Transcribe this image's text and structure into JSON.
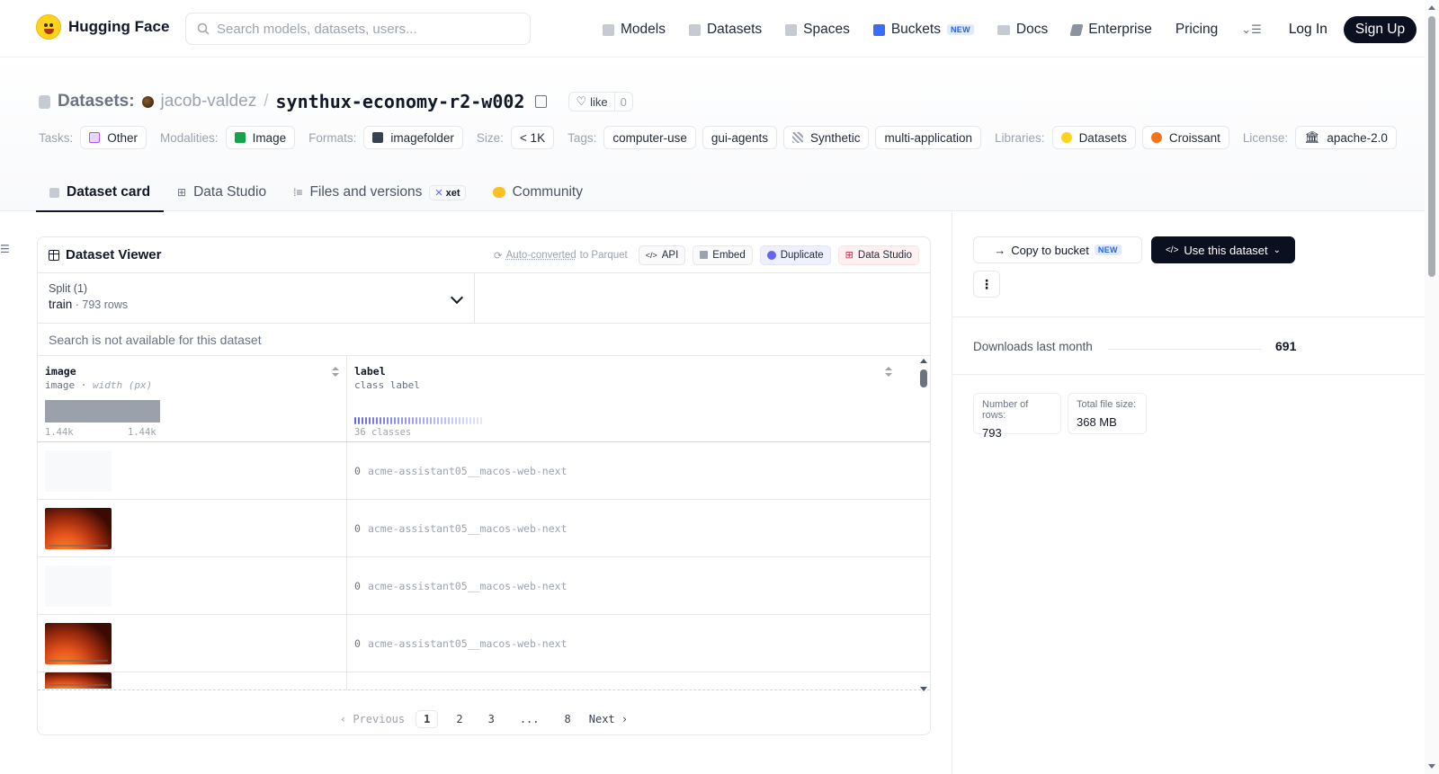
{
  "nav": {
    "brand": "Hugging Face",
    "search_placeholder": "Search models, datasets, users...",
    "items": [
      {
        "label": "Models",
        "icon": "models-icon"
      },
      {
        "label": "Datasets",
        "icon": "datasets-icon"
      },
      {
        "label": "Spaces",
        "icon": "spaces-icon"
      },
      {
        "label": "Buckets",
        "icon": "buckets-icon",
        "badge": "NEW"
      },
      {
        "label": "Docs",
        "icon": "docs-icon"
      },
      {
        "label": "Enterprise",
        "icon": "enterprise-icon"
      },
      {
        "label": "Pricing"
      }
    ],
    "login": "Log In",
    "signup": "Sign Up"
  },
  "header": {
    "section": "Datasets:",
    "user": "jacob-valdez",
    "slash": "/",
    "repo": "synthux-economy-r2-w002",
    "like_label": "like",
    "like_count": "0"
  },
  "tags": {
    "tasks_label": "Tasks:",
    "tasks": "Other",
    "modalities_label": "Modalities:",
    "modalities": "Image",
    "formats_label": "Formats:",
    "formats": "imagefolder",
    "size_label": "Size:",
    "size": "< 1K",
    "tags_label": "Tags:",
    "tag_items": [
      "computer-use",
      "gui-agents",
      "Synthetic",
      "multi-application"
    ],
    "libraries_label": "Libraries:",
    "libraries": [
      "Datasets",
      "Croissant"
    ],
    "license_label": "License:",
    "license": "apache-2.0"
  },
  "tabs": [
    {
      "label": "Dataset card",
      "active": true
    },
    {
      "label": "Data Studio"
    },
    {
      "label": "Files and versions",
      "badge": "xet"
    },
    {
      "label": "Community"
    }
  ],
  "viewer": {
    "title": "Dataset Viewer",
    "auto_converted": "Auto-converted",
    "to_parquet": " to Parquet",
    "api": "API",
    "embed": "Embed",
    "duplicate": "Duplicate",
    "data_studio": "Data Studio",
    "split_label": "Split (1)",
    "split_name": "train",
    "split_sep": " · ",
    "split_rows": "793 rows",
    "search_na": "Search is not available for this dataset",
    "columns": [
      {
        "name": "image",
        "type": "image",
        "type_sep": " · ",
        "type_extra": "width (px)"
      },
      {
        "name": "label",
        "type": "class label"
      }
    ],
    "hist_min": "1.44k",
    "hist_max": "1.44k",
    "classes": "36 classes",
    "rows": [
      {
        "image": "blank",
        "idx": "0",
        "label": "acme-assistant05__macos-web-next"
      },
      {
        "image": "img",
        "idx": "0",
        "label": "acme-assistant05__macos-web-next"
      },
      {
        "image": "blank",
        "idx": "0",
        "label": "acme-assistant05__macos-web-next"
      },
      {
        "image": "img",
        "idx": "0",
        "label": "acme-assistant05__macos-web-next"
      }
    ],
    "pager": {
      "prev": "Previous",
      "pages": [
        "1",
        "2",
        "3",
        "...",
        "8"
      ],
      "current": "1",
      "next": "Next"
    }
  },
  "sidebar": {
    "copy_bucket": "Copy to bucket",
    "copy_badge": "NEW",
    "use_dataset": "Use this dataset",
    "downloads_label": "Downloads last month",
    "downloads": "691",
    "rows_label": "Number of rows:",
    "rows_value": "793",
    "filesize_label": "Total file size:",
    "filesize_value": "368 MB"
  },
  "colors": {
    "accent_dark": "#0b1020",
    "brand_yellow": "#ffd21e",
    "class_bar": "#6366f1"
  }
}
